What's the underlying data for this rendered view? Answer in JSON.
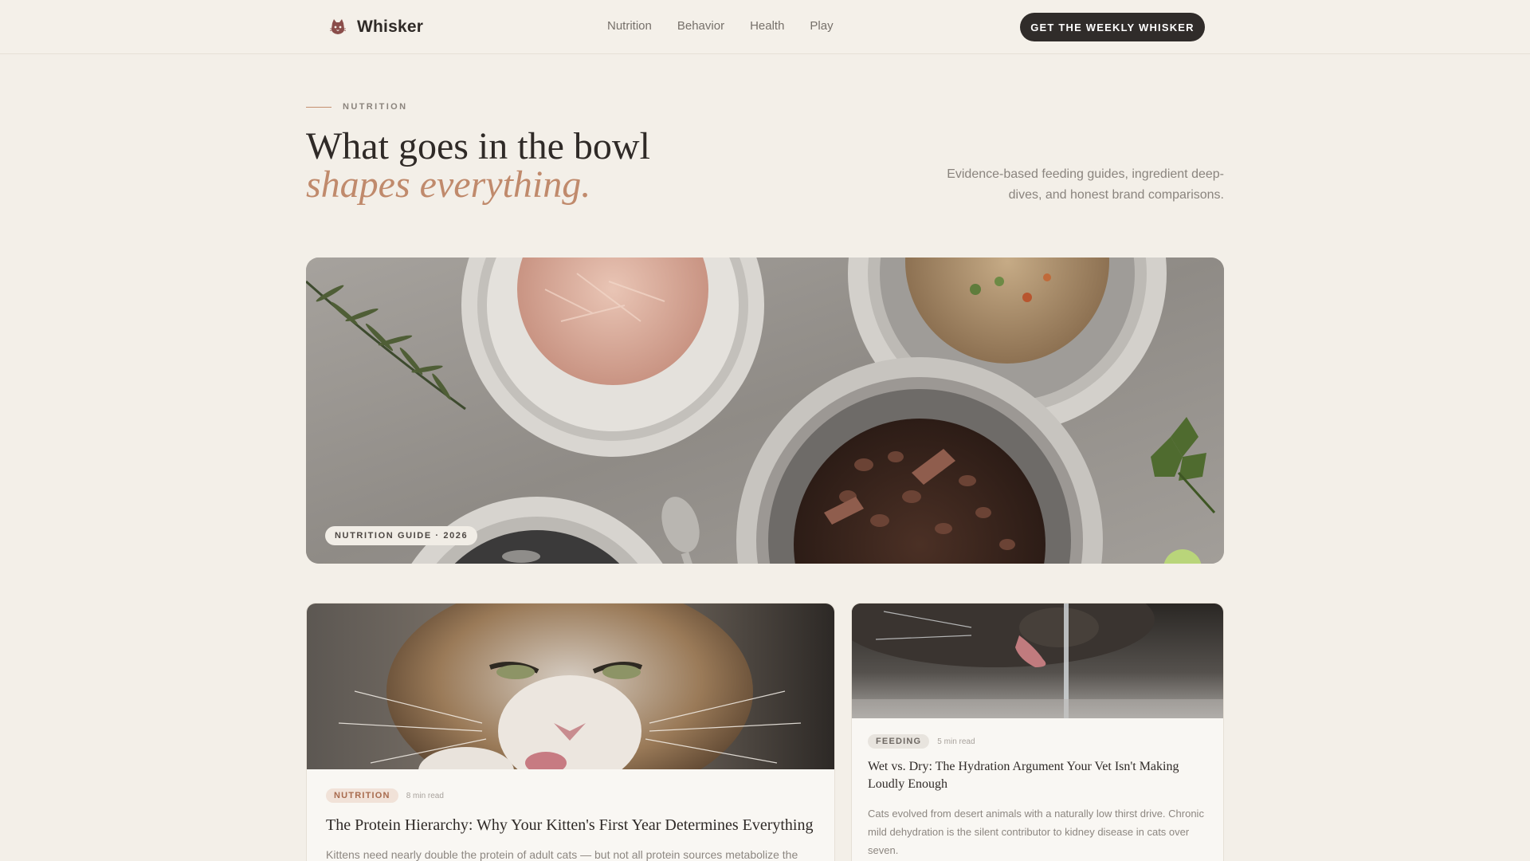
{
  "header": {
    "brand_name": "Whisker",
    "logo_icon": "cat-icon",
    "nav": [
      {
        "label": "Nutrition"
      },
      {
        "label": "Behavior"
      },
      {
        "label": "Health"
      },
      {
        "label": "Play"
      }
    ],
    "cta_label": "GET THE WEEKLY WHISKER"
  },
  "hero_section": {
    "kicker": "NUTRITION",
    "headline_line1": "What goes in the bowl",
    "headline_line2": "shapes everything.",
    "intro": "Evidence-based feeding guides, ingredient deep-dives, and honest brand comparisons."
  },
  "hero_image": {
    "badge": "NUTRITION GUIDE · 2026"
  },
  "articles": [
    {
      "tag": "NUTRITION",
      "read_time": "8 min read",
      "title": "The Protein Hierarchy: Why Your Kitten's First Year Determines Everything",
      "excerpt": "Kittens need nearly double the protein of adult cats — but not all protein sources metabolize the"
    },
    {
      "tag": "FEEDING",
      "read_time": "5 min read",
      "title": "Wet vs. Dry: The Hydration Argument Your Vet Isn't Making Loudly Enough",
      "excerpt": "Cats evolved from desert animals with a naturally low thirst drive. Chronic mild dehydration is the silent contributor to kidney disease in cats over seven."
    }
  ],
  "colors": {
    "background": "#f3efe8",
    "accent": "#c08a6c",
    "cta_background": "#302c2a",
    "text_primary": "#2f2a27",
    "text_muted": "#8a847e"
  }
}
